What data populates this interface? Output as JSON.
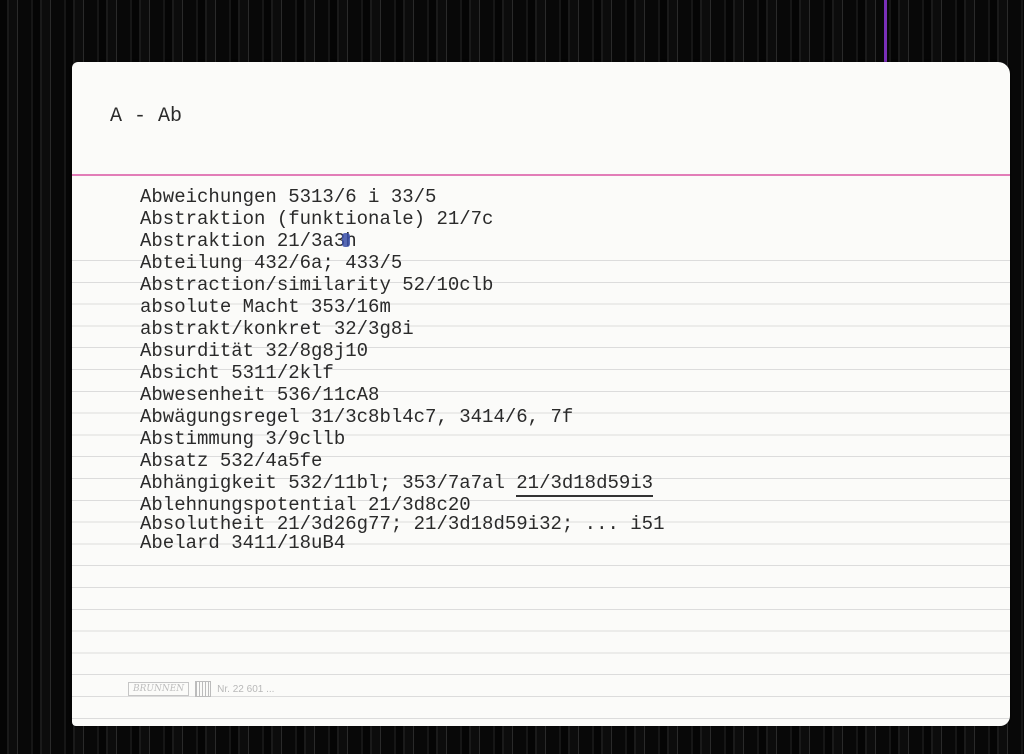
{
  "card": {
    "header": "A - Ab",
    "entries": [
      {
        "text": "Abweichungen 5313/6 i 33/5"
      },
      {
        "text": "Abstraktion (funktionale) 21/7c"
      },
      {
        "pre": "Abstraktion 21/3a3",
        "post": "h"
      },
      {
        "text": "Abteilung 432/6a; 433/5"
      },
      {
        "text": "Abstraction/similarity 52/10clb"
      },
      {
        "text": "absolute Macht 353/16m"
      },
      {
        "text": "abstrakt/konkret 32/3g8i"
      },
      {
        "text": "Absurdität 32/8g8j10"
      },
      {
        "text": "Absicht 5311/2klf"
      },
      {
        "text": "Abwesenheit 536/11cA8"
      },
      {
        "text": "Abwägungsregel 31/3c8bl4c7, 3414/6, 7f"
      },
      {
        "text": "Abstimmung 3/9cllb"
      },
      {
        "text": "Absatz 532/4a5fe"
      },
      {
        "text": "Abhängigkeit 532/11bl; 353/7a7al ",
        "underlined": "21/3d18d59i3"
      },
      {
        "text": "Ablehnungspotential 21/3d8c20"
      },
      {
        "text": "Absolutheit 21/3d26g77; 21/3d18d59i32; ... i51"
      },
      {
        "text": "Abelard 3411/18uB4"
      }
    ],
    "footer": {
      "brand": "BRUNNEN",
      "number": "Nr. 22 601 ..."
    }
  }
}
